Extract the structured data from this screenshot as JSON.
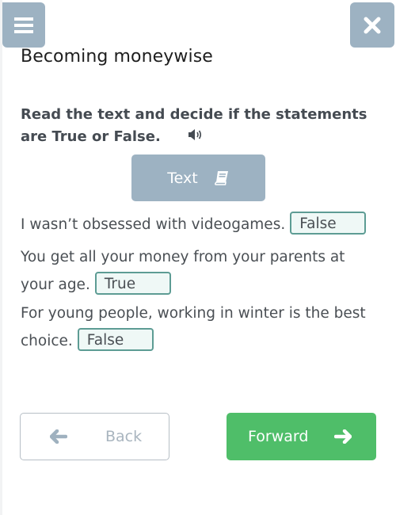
{
  "header": {
    "menu_icon": "hamburger-menu-icon",
    "close_icon": "close-x-icon",
    "title": "Becoming moneywise"
  },
  "task": {
    "instruction": "Read the text and decide if the statements are True or False.",
    "audio_icon": "speaker-volume-icon",
    "text_button_label": "Text",
    "text_button_icon": "book-icon"
  },
  "statements": [
    {
      "text": "I wasn’t obsessed with videogames.",
      "answer": "False"
    },
    {
      "text": "You get all your money from your parents at your age.",
      "answer": "True"
    },
    {
      "text": "For young people, working in winter is the best choice.",
      "answer": "False"
    }
  ],
  "navigation": {
    "back_label": "Back",
    "back_icon": "arrow-left-icon",
    "forward_label": "Forward",
    "forward_icon": "arrow-right-icon"
  },
  "colors": {
    "header_button": "#9db2c2",
    "answer_border": "#5d9c94",
    "answer_bg": "#eff8f6",
    "forward": "#4fbe69"
  }
}
